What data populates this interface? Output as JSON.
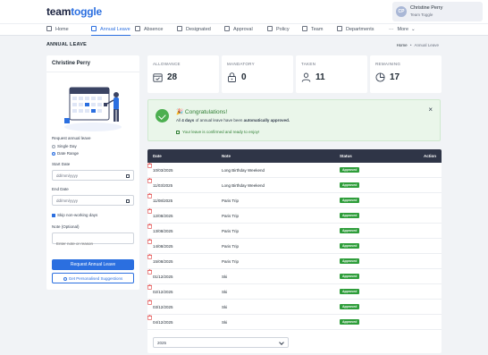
{
  "app": {
    "logo_part1": "team",
    "logo_part2": "t",
    "logo_part3": "ggle"
  },
  "user": {
    "initials": "CP",
    "name": "Christine Perry",
    "org": "Team Toggle"
  },
  "nav": {
    "items": [
      {
        "label": "Home",
        "icon": "home-icon"
      },
      {
        "label": "Annual Leave",
        "icon": "calendar-icon",
        "active": true
      },
      {
        "label": "Absence",
        "icon": "absence-icon"
      },
      {
        "label": "Designated",
        "icon": "designated-icon"
      },
      {
        "label": "Approval",
        "icon": "approval-icon"
      },
      {
        "label": "Policy",
        "icon": "policy-icon"
      },
      {
        "label": "Team",
        "icon": "team-icon"
      },
      {
        "label": "Departments",
        "icon": "departments-icon"
      }
    ],
    "more": "More"
  },
  "page": {
    "title": "ANNUAL LEAVE",
    "breadcrumb_home": "Home",
    "breadcrumb_sep": "•",
    "breadcrumb_current": "Annual Leave"
  },
  "form": {
    "employee_name": "Christine Perry",
    "request_label": "Request annual leave",
    "option_single": "Single Day",
    "option_range": "Date Range",
    "start_label": "Start Date",
    "start_placeholder": "dd/mm/yyyy",
    "end_label": "End Date",
    "end_placeholder": "dd/mm/yyyy",
    "skip_label": "Skip non-working days",
    "notes_label": "Note (Optional)",
    "notes_placeholder": "Enter note or reason",
    "submit_label": "Request Annual Leave",
    "suggest_label": "Get Personalised Suggestions"
  },
  "stats": [
    {
      "label": "ALLOWANCE",
      "value": "28",
      "icon": "calendar-icon"
    },
    {
      "label": "MANDATORY",
      "value": "0",
      "icon": "lock-icon"
    },
    {
      "label": "TAKEN",
      "value": "11",
      "icon": "person-icon"
    },
    {
      "label": "REMAINING",
      "value": "17",
      "icon": "pie-chart-icon"
    }
  ],
  "alert": {
    "title": "🎉 Congratulations!",
    "msg_prefix": "All",
    "msg_days": "4 days",
    "msg_middle": "of annual leave have been",
    "msg_bold": "automatically approved.",
    "sub": "Your leave is confirmed and ready to enjoy!",
    "close": "×"
  },
  "table": {
    "headers": {
      "date": "Date",
      "note": "Note",
      "status": "Status",
      "action": "Action"
    },
    "rows": [
      {
        "date": "10/03/2025",
        "note": "Long Birthday Weekend",
        "status": "Approved"
      },
      {
        "date": "11/03/2025",
        "note": "Long Birthday Weekend",
        "status": "Approved"
      },
      {
        "date": "11/08/2025",
        "note": "Paris Trip",
        "status": "Approved"
      },
      {
        "date": "12/08/2025",
        "note": "Paris Trip",
        "status": "Approved"
      },
      {
        "date": "13/08/2025",
        "note": "Paris Trip",
        "status": "Approved"
      },
      {
        "date": "14/08/2025",
        "note": "Paris Trip",
        "status": "Approved"
      },
      {
        "date": "15/08/2025",
        "note": "Paris Trip",
        "status": "Approved"
      },
      {
        "date": "01/12/2025",
        "note": "Ski",
        "status": "Approved"
      },
      {
        "date": "02/12/2025",
        "note": "Ski",
        "status": "Approved"
      },
      {
        "date": "03/12/2025",
        "note": "Ski",
        "status": "Approved"
      },
      {
        "date": "04/12/2025",
        "note": "Ski",
        "status": "Approved"
      }
    ],
    "year": "2025"
  },
  "colors": {
    "accent": "#2b6fe0",
    "success": "#2e9d3a",
    "danger": "#e03b3b",
    "table_header": "#2f3547"
  }
}
